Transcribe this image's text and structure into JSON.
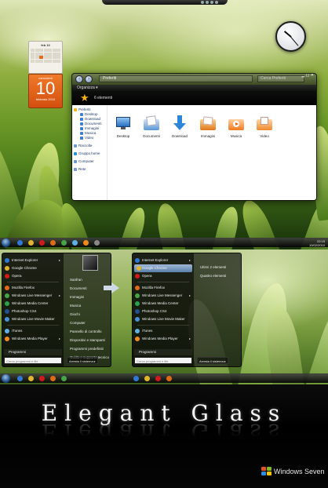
{
  "explorer": {
    "address": "Preferiti",
    "search_placeholder": "Cerca Preferiti",
    "toolbar_label": "Organizza ▾",
    "header_count": "6 elementi",
    "nav": [
      {
        "label": "Preferiti",
        "sub": false,
        "color": "#f2b21a"
      },
      {
        "label": "Desktop",
        "sub": true,
        "color": "#3f7fcf"
      },
      {
        "label": "Download",
        "sub": true,
        "color": "#3f7fcf"
      },
      {
        "label": "Documenti",
        "sub": true,
        "color": "#3f7fcf"
      },
      {
        "label": "Immagini",
        "sub": true,
        "color": "#3f7fcf"
      },
      {
        "label": "Musica",
        "sub": true,
        "color": "#3f7fcf"
      },
      {
        "label": "Video",
        "sub": true,
        "color": "#3f7fcf"
      },
      {
        "label": "Raccolte",
        "sub": false,
        "color": "#6a9bd6"
      },
      {
        "label": "Gruppo home",
        "sub": false,
        "color": "#2c8fd6"
      },
      {
        "label": "Computer",
        "sub": false,
        "color": "#6a9bd6"
      },
      {
        "label": "Rete",
        "sub": false,
        "color": "#6a9bd6"
      }
    ],
    "files": [
      {
        "label": "Desktop",
        "icon": "desktop-icon"
      },
      {
        "label": "Documenti",
        "icon": "documents-icon"
      },
      {
        "label": "Download",
        "icon": "download-icon"
      },
      {
        "label": "Immagini",
        "icon": "pictures-icon"
      },
      {
        "label": "Musica",
        "icon": "music-icon"
      },
      {
        "label": "Video",
        "icon": "video-icon"
      }
    ]
  },
  "calendar": {
    "weekday": "mercoledì",
    "day": "10",
    "month": "febbraio 2010",
    "mini_title": "feb 10"
  },
  "taskbar": {
    "time": "22:15",
    "date": "10/02/2010"
  },
  "start_menu": {
    "apps": [
      {
        "label": "Internet Explorer",
        "color": "#2f79d6",
        "has_arrow": true
      },
      {
        "label": "Google Chrome",
        "color": "#e2b62c",
        "has_arrow": false
      },
      {
        "label": "Opera",
        "color": "#d11a1a",
        "has_arrow": false
      },
      {
        "label": "Mozilla Firefox",
        "color": "#e06a16",
        "has_arrow": false
      },
      {
        "label": "Windows Live Messenger",
        "color": "#48a346",
        "has_arrow": true
      },
      {
        "label": "Windows Media Center",
        "color": "#2aa04a",
        "has_arrow": false
      },
      {
        "label": "Photoshop CS4",
        "color": "#23508f",
        "has_arrow": false
      },
      {
        "label": "Windows Live Movie Maker",
        "color": "#4b8fd8",
        "has_arrow": false
      },
      {
        "label": "iTunes",
        "color": "#5fb0e6",
        "has_arrow": false
      },
      {
        "label": "Windows Media Player",
        "color": "#f08a1c",
        "has_arrow": true
      }
    ],
    "places_left": [
      "Sanfran",
      "Documenti",
      "Immagini",
      "Musica",
      "Giochi",
      "Computer",
      "Pannello di controllo",
      "Dispositivi e stampanti",
      "Programmi predefiniti",
      "Guida e supporto tecnico"
    ],
    "places_right": [
      "Ultimi 2 elementi",
      "Quattro elementi"
    ],
    "programs_label": "Programmi",
    "search_placeholder": "Cerca programmi e file",
    "shutdown_label": "Arresta il sistema ▸"
  },
  "banner": {
    "title": "Elegant Glass",
    "brand": "Windows Seven",
    "brand_colors": [
      "#e8521c",
      "#7fba2a",
      "#2b8ee4",
      "#f7c40a"
    ]
  }
}
